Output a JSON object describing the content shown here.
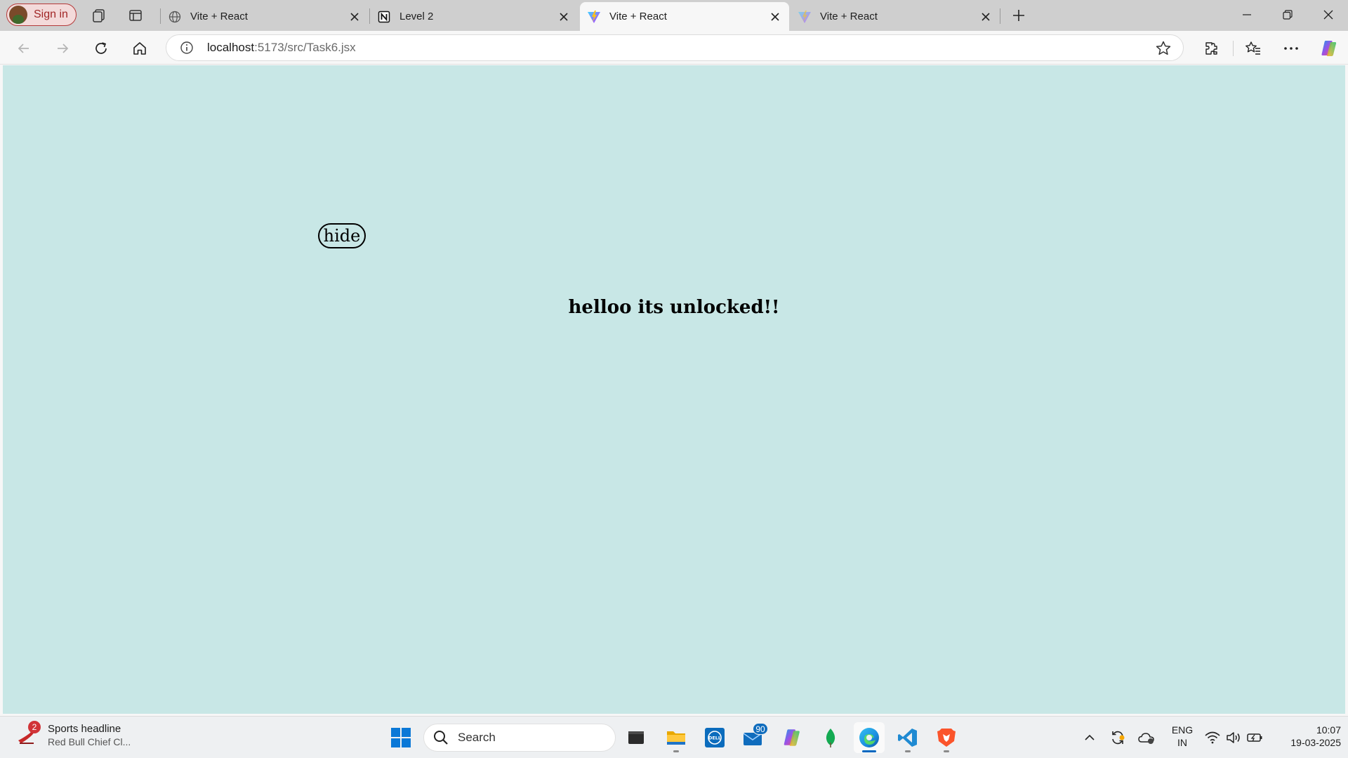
{
  "browser": {
    "signin_label": "Sign in",
    "tabs": [
      {
        "title": "Vite + React",
        "favicon": "globe-icon",
        "active": false
      },
      {
        "title": "Level 2",
        "favicon": "notion-icon",
        "active": false
      },
      {
        "title": "Vite + React",
        "favicon": "vite-icon",
        "active": true
      },
      {
        "title": "Vite + React",
        "favicon": "vite-icon",
        "active": false
      }
    ],
    "address": {
      "host": "localhost",
      "path": ":5173/src/Task6.jsx"
    }
  },
  "page": {
    "hide_button_label": "hide",
    "message": "helloo its unlocked!!",
    "background_color": "#c8e7e6"
  },
  "taskbar": {
    "news": {
      "badge_count": "2",
      "headline": "Sports headline",
      "subline": "Red Bull Chief Cl..."
    },
    "search_placeholder": "Search",
    "mail_badge": "90",
    "apps": [
      "windows-start-icon",
      "terminal-icon",
      "file-explorer-icon",
      "dell-icon",
      "mail-icon",
      "copilot-icon",
      "mongodb-icon",
      "edge-icon",
      "vscode-icon",
      "brave-icon"
    ],
    "language": {
      "line1": "ENG",
      "line2": "IN"
    },
    "clock": {
      "time": "10:07",
      "date": "19-03-2025"
    }
  }
}
